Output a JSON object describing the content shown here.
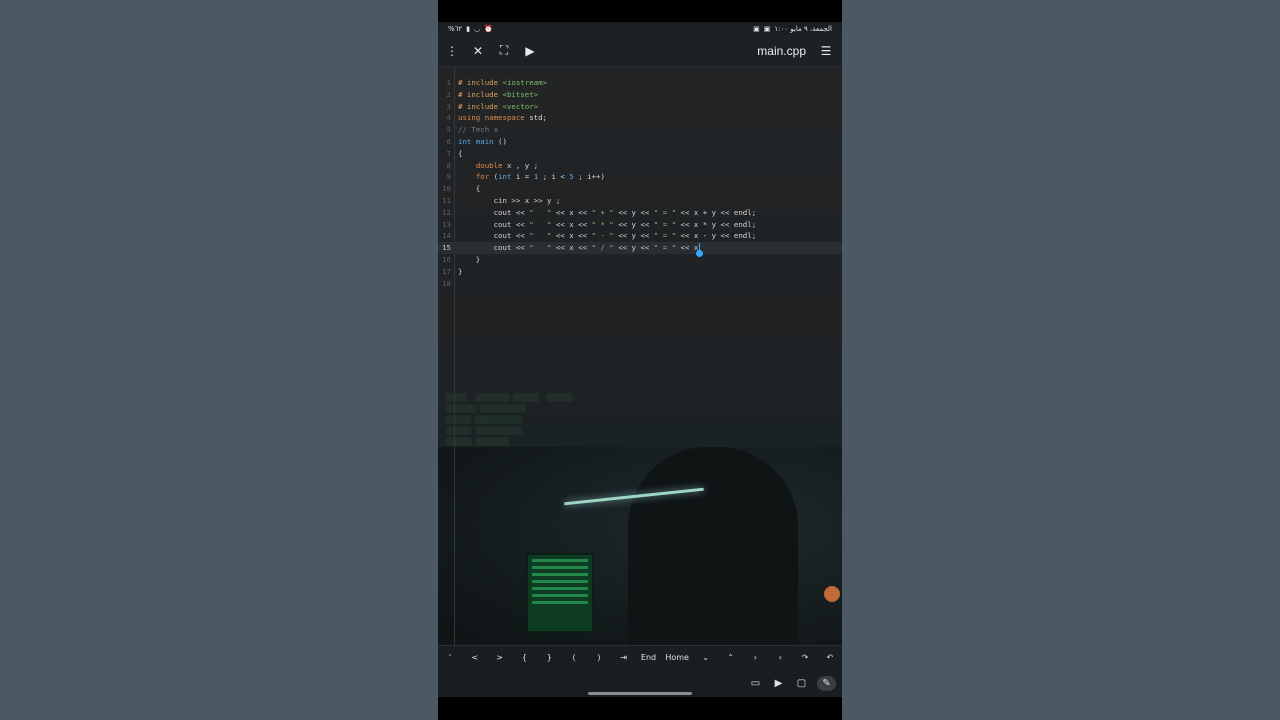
{
  "status": {
    "left_text": "%٦٢",
    "right_text": "الجمعة، ٩ مايو  ١:٠٠"
  },
  "topbar": {
    "title": "main.cpp",
    "icons": [
      "more-vert-icon",
      "close-icon",
      "fullscreen-icon",
      "run-icon",
      "menu-icon"
    ]
  },
  "editor": {
    "lines": [
      {
        "n": "1"
      },
      {
        "n": "2"
      },
      {
        "n": "3"
      },
      {
        "n": "4"
      },
      {
        "n": "5"
      },
      {
        "n": "6"
      },
      {
        "n": "7"
      },
      {
        "n": "8"
      },
      {
        "n": "9"
      },
      {
        "n": "10"
      },
      {
        "n": "11"
      },
      {
        "n": "12"
      },
      {
        "n": "13"
      },
      {
        "n": "14"
      },
      {
        "n": "15"
      },
      {
        "n": "16"
      },
      {
        "n": "17"
      },
      {
        "n": "18"
      }
    ],
    "code": [
      [
        "# include ",
        "<iostream>"
      ],
      [
        "# include ",
        "<bitset>"
      ],
      [
        "# include ",
        "<vector>"
      ],
      [
        "using namespace",
        " std;"
      ],
      [
        "// Tech x"
      ],
      [
        "int",
        " main",
        " ()"
      ],
      [
        "{"
      ],
      [
        "    ",
        "double",
        " x , y ;"
      ],
      [
        "    ",
        "for",
        " (",
        "int",
        " i = ",
        "1",
        " ; i < ",
        "5",
        " ; i++)"
      ],
      [
        "    {"
      ],
      [
        "        cin >> x >> y ;"
      ],
      [
        "        cout << ",
        "\"   \"",
        " << x << ",
        "\" + \"",
        " << y << ",
        "\" = \"",
        " << x + y << endl;"
      ],
      [
        "        cout << ",
        "\"   \"",
        " << x << ",
        "\" * \"",
        " << y << ",
        "\" = \"",
        " << x * y << endl;"
      ],
      [
        "        cout << ",
        "\"   \"",
        " << x << ",
        "\" - \"",
        " << y << ",
        "\" = \"",
        " << x - y << endl;"
      ],
      [
        "        cout << ",
        "\"   \"",
        " << x << ",
        "\" / \"",
        " << y << ",
        "\" = \"",
        " << x"
      ],
      [
        "    }"
      ],
      [
        "}"
      ],
      [
        ""
      ]
    ],
    "active_line": "15"
  },
  "keys": [
    "'",
    "<",
    ">",
    "{",
    "}",
    "(",
    ")",
    "⇥",
    "End",
    "Home",
    "⌄",
    "⌃",
    "›",
    "‹",
    "↷",
    "↶"
  ],
  "bottom_icons": [
    "terminal-icon",
    "play-icon",
    "folder-icon",
    "edit-icon"
  ]
}
